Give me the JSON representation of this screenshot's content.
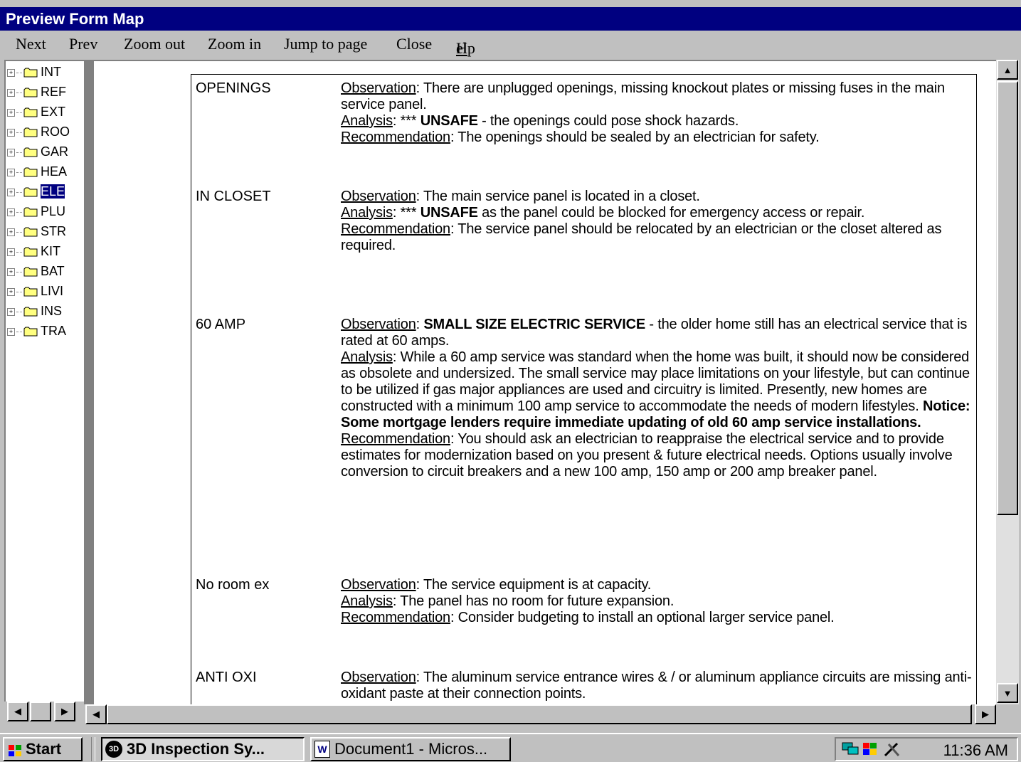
{
  "window": {
    "title": "Preview Form Map"
  },
  "menu": {
    "next": "Next",
    "prev": "Prev",
    "zoom_out": "Zoom out",
    "zoom_in": "Zoom in",
    "jump": "Jump to page",
    "close": "Close",
    "help_h": "H",
    "help_rest": "elp"
  },
  "tree": {
    "items": [
      {
        "label": "INT"
      },
      {
        "label": "REF"
      },
      {
        "label": "EXT"
      },
      {
        "label": "ROO"
      },
      {
        "label": "GAR"
      },
      {
        "label": "HEA"
      },
      {
        "label": "ELE"
      },
      {
        "label": "PLU"
      },
      {
        "label": "STR"
      },
      {
        "label": "KIT"
      },
      {
        "label": "BAT"
      },
      {
        "label": "LIVI"
      },
      {
        "label": "INS"
      },
      {
        "label": "TRA"
      }
    ]
  },
  "labels": {
    "observation": "Observation",
    "analysis": "Analysis",
    "recommendation": "Recommendation"
  },
  "sections": {
    "openings": {
      "title": "OPENINGS",
      "obs": ":  There are unplugged openings, missing knockout plates or missing fuses in the main service panel.",
      "ana_pre": ":  *** ",
      "ana_bold": "UNSAFE",
      "ana_post": " - the openings could pose shock hazards.",
      "rec": ":  The openings should be sealed by an electrician for safety."
    },
    "closet": {
      "title": "IN CLOSET",
      "obs": ":  The main service panel is located in a closet.",
      "ana_pre": ":  *** ",
      "ana_bold": "UNSAFE",
      "ana_post": " as the panel could be blocked for emergency access or repair.",
      "rec": ":  The service panel should be relocated by an electrician or the closet altered as required."
    },
    "amp60": {
      "title": "60 AMP",
      "obs_pre": ":  ",
      "obs_bold": "SMALL SIZE ELECTRIC SERVICE",
      "obs_post": " - the older home still has an electrical service that is rated at 60 amps.",
      "ana": ":  While a 60 amp service was standard when the home was built, it should now be considered as obsolete and undersized.  The small service may place limitations on your lifestyle, but can continue to be utilized if gas major appliances are used and circuitry is limited.  Presently, new homes are constructed with a minimum 100 amp service to accommodate the needs of modern lifestyles. ",
      "ana_bold": "Notice:  Some mortgage lenders require immediate updating of old 60 amp service installations.",
      "rec": ":  You should ask an electrician to reappraise the electrical service and to provide estimates for modernization based on you present & future electrical needs.  Options usually involve conversion to circuit breakers and a new 100 amp, 150 amp or 200 amp breaker panel."
    },
    "noroom": {
      "title": "No room ex",
      "obs": ":  The service equipment is at capacity.",
      "ana": ": The panel has no room for future expansion.",
      "rec": ":  Consider budgeting to install an optional larger service panel."
    },
    "antioxi": {
      "title": "ANTI OXI",
      "obs": ":  The aluminum service entrance wires & / or aluminum appliance circuits are missing anti-oxidant paste at their connection points."
    }
  },
  "taskbar": {
    "start": "Start",
    "task1": "3D Inspection Sy...",
    "task2": "Document1 - Micros...",
    "clock": "11:36 AM"
  }
}
